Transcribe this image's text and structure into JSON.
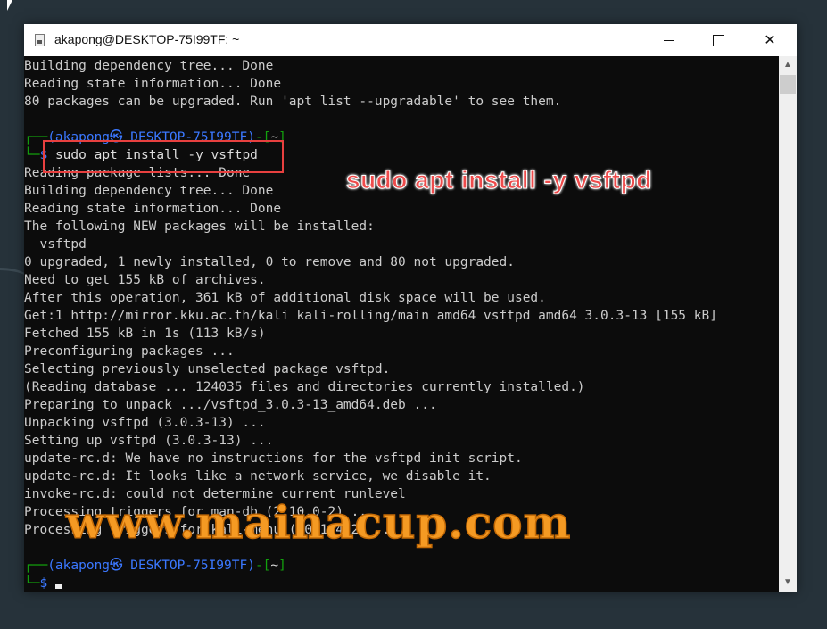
{
  "window": {
    "title": "akapong@DESKTOP-75I99TF: ~",
    "controls": {
      "minimize": "minimize",
      "maximize": "maximize",
      "close": "close"
    }
  },
  "terminal": {
    "lines_before": [
      "Building dependency tree... Done",
      "Reading state information... Done",
      "80 packages can be upgraded. Run 'apt list --upgradable' to see them."
    ],
    "prompt1": {
      "user": "akapong",
      "host": "DESKTOP-75I99TF",
      "dir": "~",
      "symbol": "$",
      "command": "sudo apt install -y vsftpd"
    },
    "output": [
      "Reading package lists... Done",
      "Building dependency tree... Done",
      "Reading state information... Done",
      "The following NEW packages will be installed:",
      "  vsftpd",
      "0 upgraded, 1 newly installed, 0 to remove and 80 not upgraded.",
      "Need to get 155 kB of archives.",
      "After this operation, 361 kB of additional disk space will be used.",
      "Get:1 http://mirror.kku.ac.th/kali kali-rolling/main amd64 vsftpd amd64 3.0.3-13 [155 kB]",
      "Fetched 155 kB in 1s (113 kB/s)",
      "Preconfiguring packages ...",
      "Selecting previously unselected package vsftpd.",
      "(Reading database ... 124035 files and directories currently installed.)",
      "Preparing to unpack .../vsftpd_3.0.3-13_amd64.deb ...",
      "Unpacking vsftpd (3.0.3-13) ...",
      "Setting up vsftpd (3.0.3-13) ...",
      "update-rc.d: We have no instructions for the vsftpd init script.",
      "update-rc.d: It looks like a network service, we disable it.",
      "invoke-rc.d: could not determine current runlevel",
      "Processing triggers for man-db (2.10.0-2) ...",
      "Processing triggers for kali-menu (2021.4.2) ..."
    ],
    "prompt2": {
      "user": "akapong",
      "host": "DESKTOP-75I99TF",
      "dir": "~",
      "symbol": "$"
    }
  },
  "annotations": {
    "caption": "sudo apt install -y vsftpd",
    "watermark": "www.mainacup.com",
    "caption_color": "#ee4b4b",
    "watermark_color": "#f59a23"
  }
}
